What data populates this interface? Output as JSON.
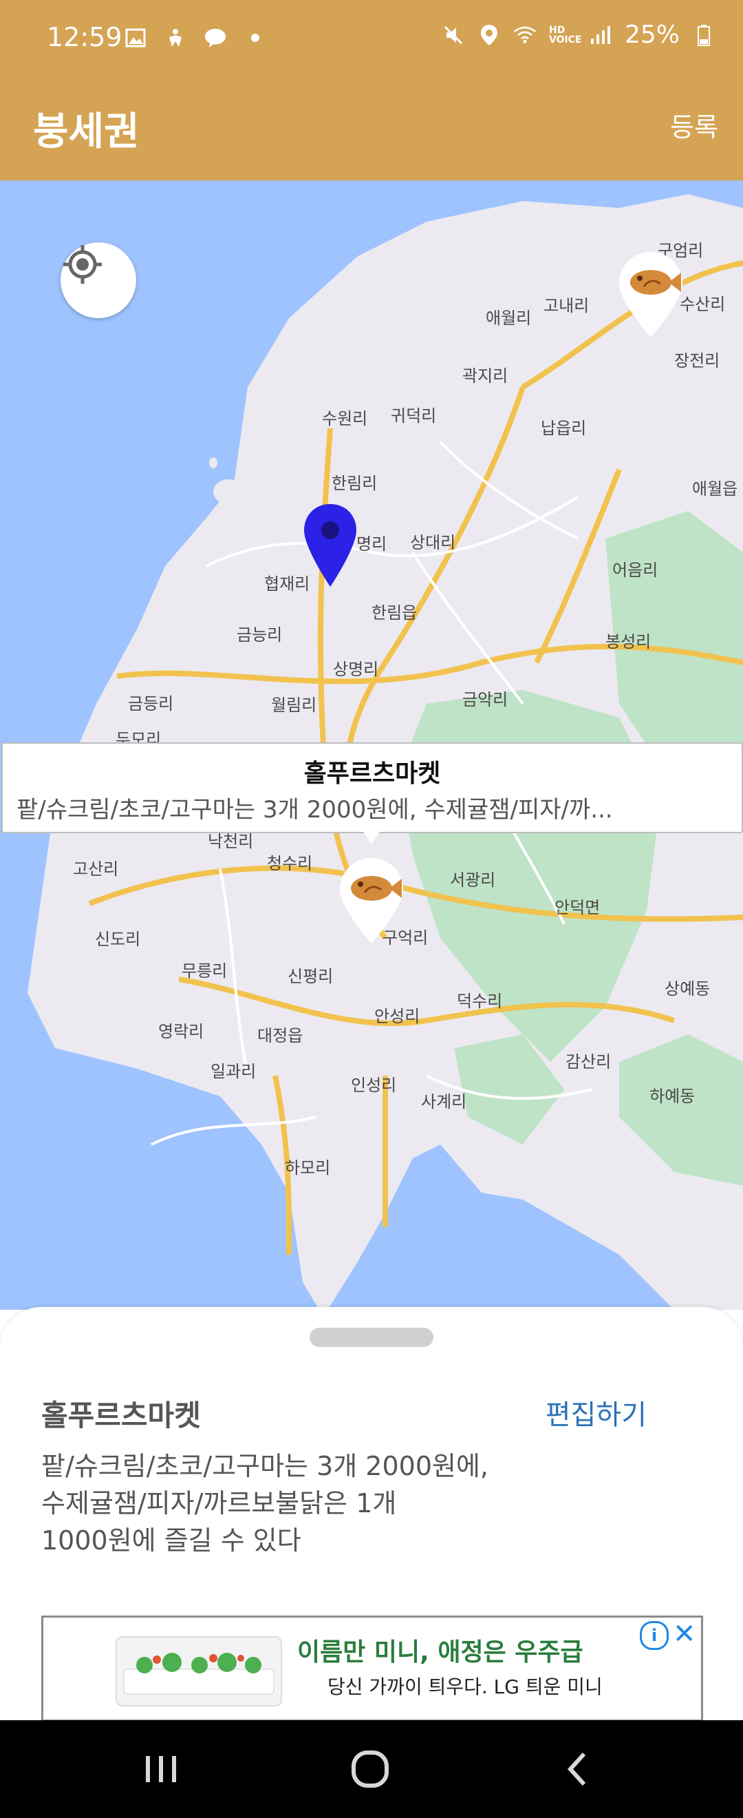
{
  "status_bar": {
    "time": "12:59",
    "battery": "25%",
    "network": "HD VOICE",
    "left_icons": [
      "image-icon",
      "accessibility-icon",
      "talk-icon",
      "dot-icon"
    ],
    "right_icons": [
      "mute-icon",
      "location-icon",
      "wifi-icon",
      "signal-icon",
      "battery-icon"
    ]
  },
  "app_bar": {
    "title": "붕세권",
    "register_label": "등록",
    "background": "#d4a354"
  },
  "map": {
    "places": [
      "구엄리",
      "고내리",
      "애월리",
      "수산리",
      "장전리",
      "곽지리",
      "수원리",
      "귀덕리",
      "납읍리",
      "애월읍",
      "한림리",
      "명리",
      "상대리",
      "어음리",
      "협재리",
      "한림읍",
      "금능리",
      "봉성리",
      "상명리",
      "금등리",
      "월림리",
      "금악리",
      "두모리",
      "낙천리",
      "청수리",
      "고산리",
      "서광리",
      "안덕면",
      "신도리",
      "구억리",
      "무릉리",
      "신평리",
      "상예동",
      "영락리",
      "안성리",
      "덕수리",
      "대정읍",
      "감산리",
      "일과리",
      "인성리",
      "사계리",
      "하예동",
      "하모리"
    ]
  },
  "callout": {
    "title": "홀푸르츠마켓",
    "description": "팥/슈크림/초코/고구마는 3개 2000원에, 수제귤잼/피자/까..."
  },
  "sheet": {
    "title": "홀푸르츠마켓",
    "edit_label": "편집하기",
    "description": "팥/슈크림/초코/고구마는 3개 2000원에,\n수제귤잼/피자/까르보불닭은 1개\n1000원에 즐길 수 있다"
  },
  "ad": {
    "headline": "이름만 미니, 애정은 우주급",
    "subtext": "당신 가까이 틔우다. LG 틔운 미니"
  },
  "navbar": {
    "buttons": [
      "recent-apps-icon",
      "home-icon",
      "back-icon"
    ]
  }
}
